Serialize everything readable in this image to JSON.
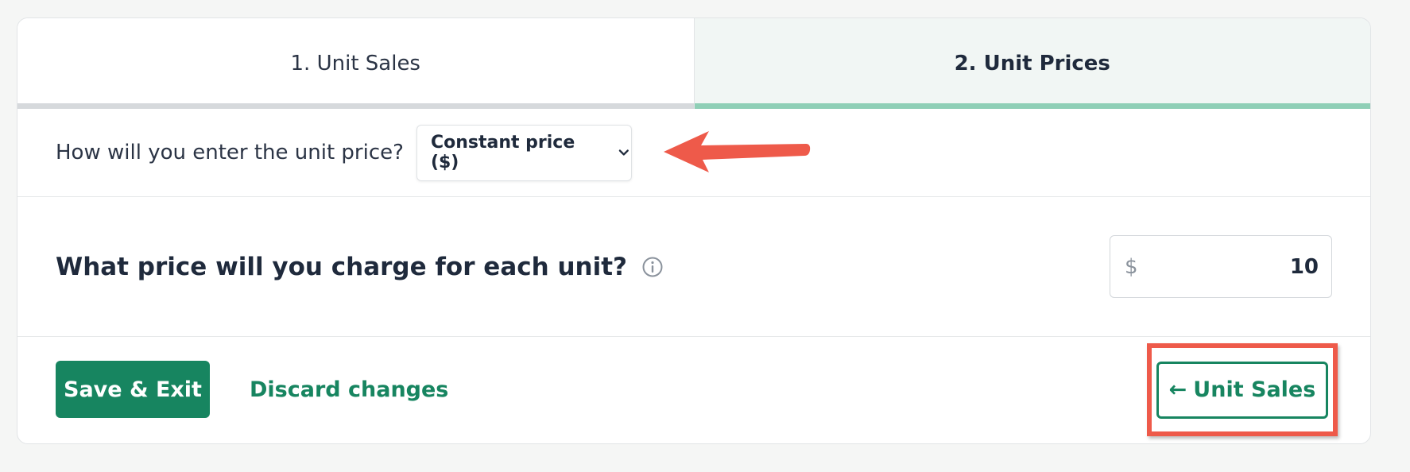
{
  "tabs": [
    {
      "label": "1. Unit Sales"
    },
    {
      "label": "2. Unit Prices"
    }
  ],
  "method": {
    "question": "How will you enter the unit price?",
    "selected": "Constant price ($)"
  },
  "price": {
    "question": "What price will you charge for each unit?",
    "currency": "$",
    "value": "10"
  },
  "actions": {
    "save": "Save & Exit",
    "discard": "Discard changes",
    "back_arrow": "←",
    "back": "Unit Sales"
  },
  "colors": {
    "brand": "#178560",
    "annotation": "#ee5a4a",
    "active_tab_bar": "#8fcfb6"
  },
  "icons": [
    "chevron-down-icon",
    "info-icon",
    "left-arrow-icon"
  ]
}
